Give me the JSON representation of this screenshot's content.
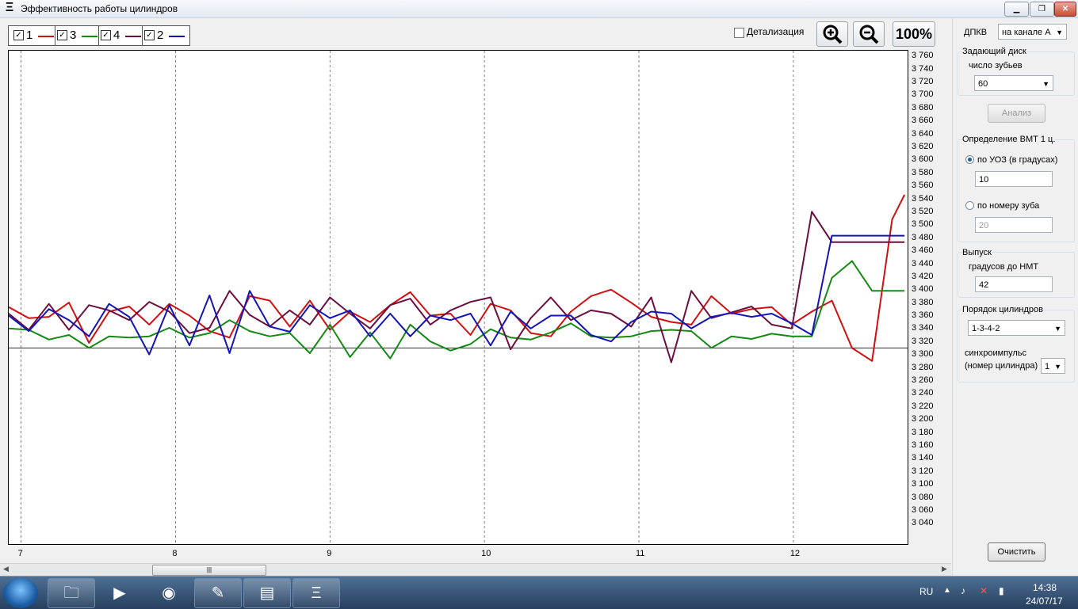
{
  "window": {
    "title": "Эффективность работы цилиндров"
  },
  "legend": [
    {
      "label": "1",
      "checked": true,
      "color": "#d01010"
    },
    {
      "label": "3",
      "checked": true,
      "color": "#138a13"
    },
    {
      "label": "4",
      "checked": true,
      "color": "#6a0f3f"
    },
    {
      "label": "2",
      "checked": true,
      "color": "#1414b8"
    }
  ],
  "toolbar": {
    "detail_label": "Детализация",
    "zoom_percent": "100%"
  },
  "chart_data": {
    "type": "line",
    "y_ticks": [
      "3 760",
      "3 740",
      "3 720",
      "3 700",
      "3 680",
      "3 660",
      "3 640",
      "3 620",
      "3 600",
      "3 580",
      "3 560",
      "3 540",
      "3 520",
      "3 500",
      "3 480",
      "3 460",
      "3 440",
      "3 420",
      "3 400",
      "3 380",
      "3 360",
      "3 340",
      "3 320",
      "3 300",
      "3 280",
      "3 260",
      "3 240",
      "3 220",
      "3 200",
      "3 180",
      "3 160",
      "3 140",
      "3 120",
      "3 100",
      "3 080",
      "3 060",
      "3 040"
    ],
    "y_tick_values": [
      3760,
      3740,
      3720,
      3700,
      3680,
      3660,
      3640,
      3620,
      3600,
      3580,
      3560,
      3540,
      3520,
      3500,
      3480,
      3460,
      3440,
      3420,
      3400,
      3380,
      3360,
      3340,
      3320,
      3300,
      3280,
      3260,
      3240,
      3220,
      3200,
      3180,
      3160,
      3140,
      3120,
      3100,
      3080,
      3060,
      3040
    ],
    "x_ticks": [
      "7",
      "8",
      "9",
      "10",
      "11",
      "12"
    ],
    "x_tick_values": [
      7,
      8,
      9,
      10,
      11,
      12
    ],
    "x_range": [
      6.92,
      12.74
    ],
    "y_range": [
      3010,
      3770
    ],
    "reference_line": 3312,
    "x": [
      6.92,
      7.05,
      7.18,
      7.31,
      7.44,
      7.57,
      7.7,
      7.83,
      7.96,
      8.09,
      8.22,
      8.35,
      8.48,
      8.61,
      8.74,
      8.87,
      9.0,
      9.13,
      9.26,
      9.39,
      9.52,
      9.65,
      9.78,
      9.91,
      10.04,
      10.17,
      10.3,
      10.43,
      10.56,
      10.69,
      10.82,
      10.95,
      11.08,
      11.21,
      11.34,
      11.47,
      11.6,
      11.73,
      11.86,
      11.99,
      12.12,
      12.25,
      12.38,
      12.51,
      12.64,
      12.72
    ],
    "series": [
      {
        "name": "1",
        "color": "#d01010",
        "values": [
          3375,
          3358,
          3360,
          3382,
          3320,
          3368,
          3376,
          3348,
          3380,
          3362,
          3338,
          3328,
          3392,
          3385,
          3345,
          3385,
          3340,
          3368,
          3352,
          3378,
          3398,
          3362,
          3365,
          3332,
          3380,
          3370,
          3335,
          3330,
          3368,
          3392,
          3402,
          3382,
          3360,
          3352,
          3348,
          3392,
          3365,
          3372,
          3375,
          3348,
          3368,
          3385,
          3312,
          3292,
          3510,
          3548
        ]
      },
      {
        "name": "3",
        "color": "#138a13",
        "values": [
          3342,
          3340,
          3325,
          3332,
          3312,
          3330,
          3328,
          3330,
          3343,
          3328,
          3335,
          3355,
          3338,
          3330,
          3335,
          3304,
          3348,
          3298,
          3336,
          3296,
          3348,
          3322,
          3308,
          3318,
          3341,
          3328,
          3325,
          3336,
          3350,
          3330,
          3328,
          3330,
          3338,
          3340,
          3338,
          3312,
          3330,
          3326,
          3334,
          3330,
          3330,
          3420,
          3446,
          3400,
          3400,
          3400
        ]
      },
      {
        "name": "4",
        "color": "#6a0f3f",
        "values": [
          3365,
          3340,
          3380,
          3340,
          3378,
          3370,
          3355,
          3383,
          3368,
          3335,
          3343,
          3400,
          3363,
          3345,
          3370,
          3348,
          3390,
          3365,
          3342,
          3378,
          3388,
          3348,
          3370,
          3383,
          3390,
          3310,
          3358,
          3390,
          3355,
          3370,
          3365,
          3345,
          3390,
          3290,
          3400,
          3358,
          3367,
          3376,
          3348,
          3342,
          3522,
          3475,
          3475,
          3475,
          3475,
          3475
        ]
      },
      {
        "name": "2",
        "color": "#1414b8",
        "values": [
          3362,
          3338,
          3372,
          3355,
          3330,
          3380,
          3360,
          3302,
          3378,
          3316,
          3393,
          3304,
          3400,
          3345,
          3337,
          3378,
          3358,
          3370,
          3330,
          3365,
          3330,
          3362,
          3355,
          3365,
          3316,
          3368,
          3342,
          3362,
          3362,
          3332,
          3322,
          3352,
          3368,
          3365,
          3342,
          3360,
          3366,
          3360,
          3365,
          3350,
          3332,
          3485,
          3485,
          3485,
          3485,
          3485
        ]
      }
    ]
  },
  "sidebar": {
    "dpkv_label": "ДПКВ",
    "dpkv_value": "на канале А",
    "master_disk_label": "Задающий диск",
    "teeth_label": "число зубьев",
    "teeth_value": "60",
    "analyze_button": "Анализ",
    "tdc_group_label": "Определение ВМТ 1 ц.",
    "by_uoz_label": "по УОЗ (в градусах)",
    "by_uoz_value": "10",
    "by_tooth_label": "по номеру зуба",
    "by_tooth_value": "20",
    "exhaust_label": "Выпуск",
    "degrees_bdc_label": "градусов до НМТ",
    "degrees_bdc_value": "42",
    "firing_order_label": "Порядок цилиндров",
    "firing_order_value": "1-3-4-2",
    "sync_label_1": "синхроимпульс",
    "sync_label_2": "(номер цилиндра)",
    "sync_value": "1",
    "clear_button": "Очистить"
  },
  "taskbar": {
    "language": "RU",
    "time": "14:38",
    "date": "24/07/17"
  }
}
